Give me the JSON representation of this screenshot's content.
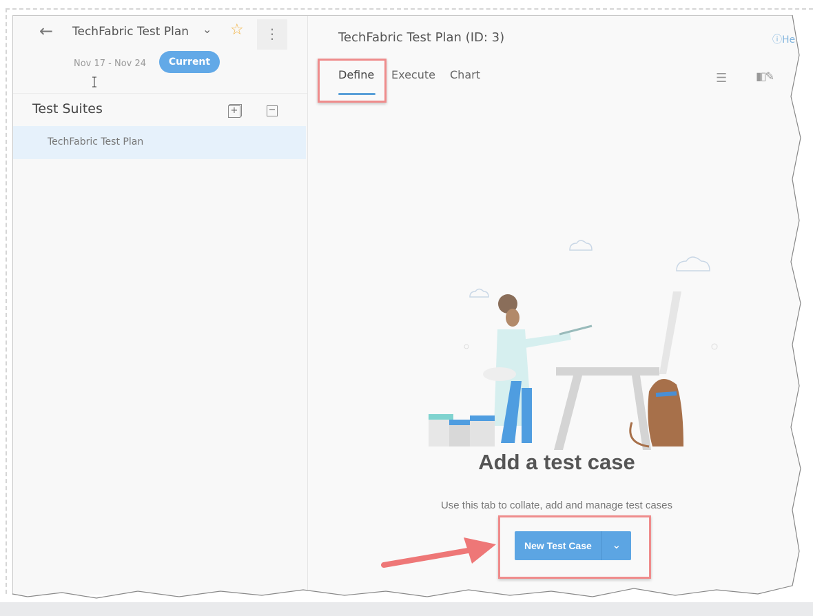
{
  "header": {
    "back_icon": "arrow-left-icon",
    "plan_name": "TechFabric Test Plan",
    "plan_dropdown_icon": "chevron-down-icon",
    "favorite_icon": "star-icon",
    "more_icon": "more-vertical-icon",
    "date_range": "Nov 17 - Nov 24",
    "status_badge": "Current"
  },
  "sidebar": {
    "title": "Test Suites",
    "expand_all_icon": "expand-all-icon",
    "collapse_all_icon": "collapse-all-icon",
    "suites": [
      {
        "label": "TechFabric Test Plan",
        "selected": true
      }
    ]
  },
  "main": {
    "title": "TechFabric Test Plan (ID: 3)",
    "help_label": "He",
    "help_icon": "help-circle-icon",
    "tabs": [
      {
        "label": "Define",
        "active": true
      },
      {
        "label": "Execute",
        "active": false
      },
      {
        "label": "Chart",
        "active": false
      }
    ],
    "toolbar_icons": [
      "filter-lines-icon",
      "column-options-icon"
    ],
    "empty_state": {
      "illustration": "painter-with-easel-and-dog",
      "title": "Add a test case",
      "description": "Use this tab to collate, add and manage test cases",
      "primary_button": "New Test Case",
      "dropdown_icon": "chevron-down-icon"
    }
  },
  "colors": {
    "accent": "#5ca5e3",
    "badge": "#62a9e7",
    "highlight_annotation": "#ef8c8c",
    "star": "#f2b13c",
    "selected_row": "#e6f1fb"
  }
}
